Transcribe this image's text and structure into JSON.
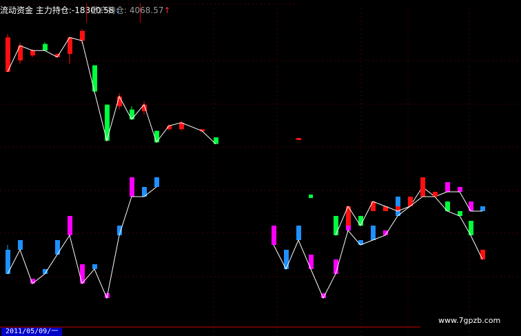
{
  "header": {
    "series1_label": "流动资金 主力持仓:",
    "series1_value": "-18300.58",
    "series1_arrow": "↓",
    "series2_label": "散户持仓:",
    "series2_value": "4068.57",
    "series2_arrow": "↑"
  },
  "footer": {
    "date_label": "2011/05/09/一",
    "watermark": "www.7gpzb.com"
  },
  "colors": {
    "background": "#000000",
    "grid": "#8b0000",
    "up": "#ff1010",
    "down": "#00ff3c",
    "retail_up": "#ff00ff",
    "retail_down": "#1e90ff",
    "line": "#ffffff"
  },
  "chart_data": {
    "type": "candlestick",
    "series": [
      {
        "name": "主力持仓",
        "color_up": "#ff1010",
        "color_down": "#00ff3c",
        "candles": [
          {
            "open": 94,
            "close": 73,
            "high": 73,
            "low": 96,
            "up": true
          },
          {
            "open": 80,
            "close": 89,
            "high": 78,
            "low": 91,
            "up": true
          },
          {
            "open": 83,
            "close": 86,
            "high": 82,
            "low": 87,
            "up": true
          },
          {
            "open": 90,
            "close": 86,
            "high": 86,
            "low": 91,
            "up": false
          },
          {
            "open": 84,
            "close": 82,
            "high": 82,
            "low": 84,
            "up": true
          },
          {
            "open": 84,
            "close": 94,
            "high": 78,
            "low": 94,
            "up": true
          },
          {
            "open": 98,
            "close": 92,
            "high": 90,
            "low": 99,
            "up": true
          },
          {
            "open": 77,
            "close": 61,
            "high": 60,
            "low": 77,
            "up": false
          },
          {
            "open": 53,
            "close": 31,
            "high": 31,
            "low": 53,
            "up": false
          },
          {
            "open": 52,
            "close": 58,
            "high": 50,
            "low": 60,
            "up": true
          },
          {
            "open": 50,
            "close": 44,
            "high": 44,
            "low": 52,
            "up": false
          },
          {
            "open": 49,
            "close": 53,
            "high": 47,
            "low": 55,
            "up": true
          },
          {
            "open": 37,
            "close": 30,
            "high": 30,
            "low": 37,
            "up": false
          },
          {
            "open": 38,
            "close": 40,
            "high": 37,
            "low": 41,
            "up": true
          },
          {
            "open": 38,
            "close": 42,
            "high": 37,
            "low": 43,
            "up": true
          },
          {
            "open": 38,
            "close": 37,
            "high": 36,
            "low": 38,
            "up": true
          },
          {
            "open": 33,
            "close": 29,
            "high": 29,
            "low": 33,
            "up": false
          }
        ]
      },
      {
        "name": "散户持仓",
        "color_up": "#ff00ff",
        "color_down": "#1e90ff",
        "candles": [
          {
            "open": 9,
            "close": 4,
            "high": 4,
            "low": 10,
            "up": false
          },
          {
            "open": 11,
            "close": 9,
            "high": 9,
            "low": 11,
            "up": false
          },
          {
            "open": 3,
            "close": 2,
            "high": 2,
            "low": 3,
            "up": true
          },
          {
            "open": 5,
            "close": 4,
            "high": 4,
            "low": 5,
            "up": false
          },
          {
            "open": 11,
            "close": 8,
            "high": 8,
            "low": 11,
            "up": false
          },
          {
            "open": 16,
            "close": 12,
            "high": 12,
            "low": 16,
            "up": true
          },
          {
            "open": 6,
            "close": 2,
            "high": 2,
            "low": 6,
            "up": true
          },
          {
            "open": 6,
            "close": 5,
            "high": 5,
            "low": 6,
            "up": false
          },
          {
            "open": 0,
            "close": -1,
            "high": -1,
            "low": 0,
            "up": true
          },
          {
            "open": 14,
            "close": 12,
            "high": 12,
            "low": 14,
            "up": false
          },
          {
            "open": 24,
            "close": 20,
            "high": 20,
            "low": 24,
            "up": true
          },
          {
            "open": 22,
            "close": 20,
            "high": 20,
            "low": 22,
            "up": false
          },
          {
            "open": 24,
            "close": 22,
            "high": 22,
            "low": 24,
            "up": false
          }
        ]
      }
    ]
  }
}
